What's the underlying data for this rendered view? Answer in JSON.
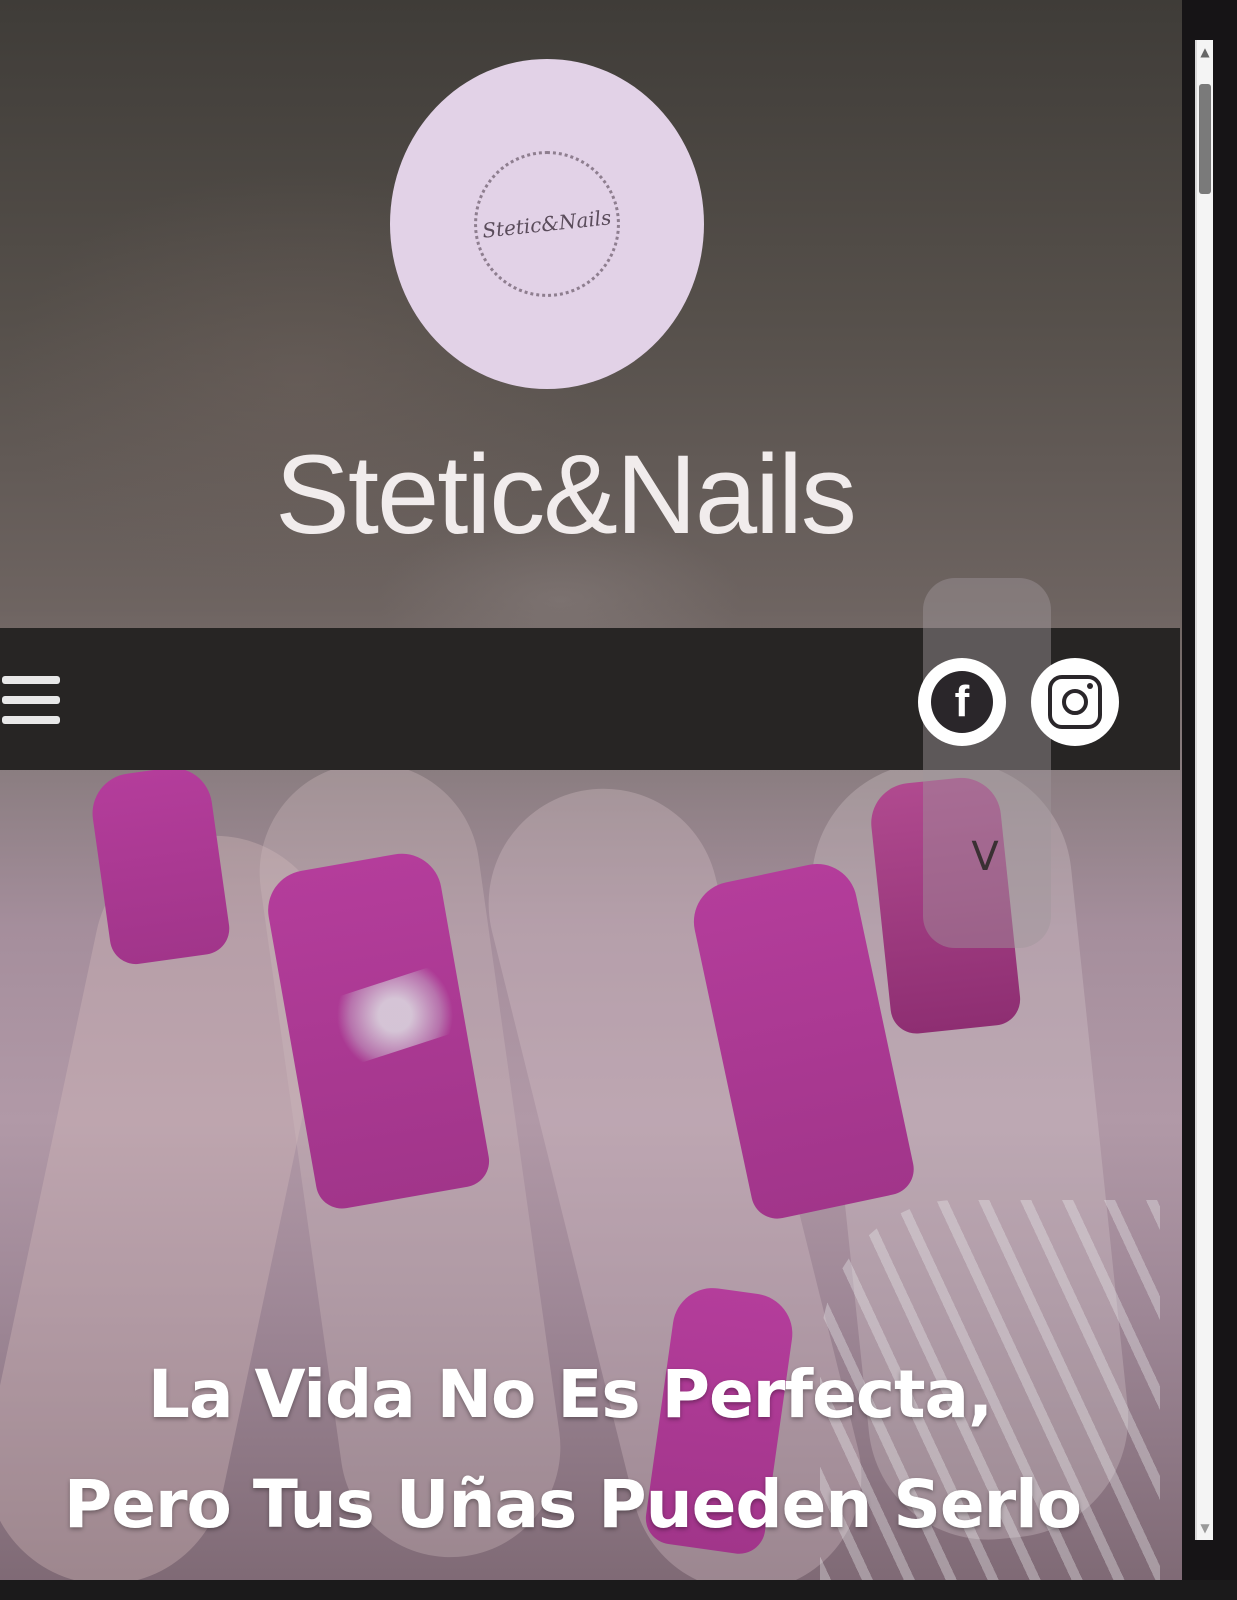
{
  "site": {
    "title": "Stetic&Nails",
    "logo_text": "Stetic&Nails"
  },
  "nav": {
    "menu_icon": "hamburger-menu-icon"
  },
  "social": {
    "facebook_icon": "facebook-icon",
    "facebook_glyph": "f",
    "instagram_icon": "instagram-icon",
    "toggle_glyph": "V"
  },
  "hero": {
    "tagline_line1": "La Vida No Es Perfecta,",
    "tagline_line2": "Pero Tus Uñas Pueden Serlo"
  },
  "colors": {
    "nail_pink": "#b43d9b",
    "navbar": "#272524",
    "logo_circle": "#e2d2e7"
  }
}
